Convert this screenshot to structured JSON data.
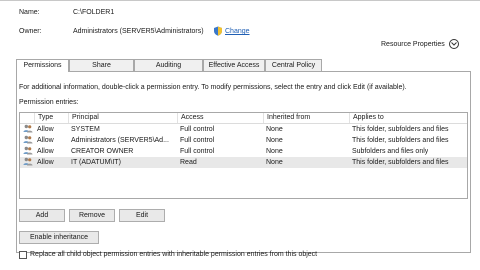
{
  "header": {
    "name_label": "Name:",
    "name_value": "C:\\FOLDER1",
    "owner_label": "Owner:",
    "owner_value": "Administrators (SERVER5\\Administrators)",
    "change_link": "Change",
    "resource_properties": "Resource Properties"
  },
  "tabs": [
    "Permissions",
    "Share",
    "Auditing",
    "Effective Access",
    "Central Policy"
  ],
  "active_tab": "Permissions",
  "info_text": "For additional information, double-click a permission entry. To modify permissions, select the entry and click Edit (if available).",
  "entries_label": "Permission entries:",
  "table": {
    "columns": [
      "Type",
      "Principal",
      "Access",
      "Inherited from",
      "Applies to"
    ],
    "rows": [
      [
        "Allow",
        "SYSTEM",
        "Full control",
        "None",
        "This folder, subfolders and files"
      ],
      [
        "Allow",
        "Administrators (SERVER5\\Ad...",
        "Full control",
        "None",
        "This folder, subfolders and files"
      ],
      [
        "Allow",
        "CREATOR OWNER",
        "Full control",
        "None",
        "Subfolders and files only"
      ],
      [
        "Allow",
        "IT (ADATUM\\IT)",
        "Read",
        "None",
        "This folder, subfolders and files"
      ]
    ],
    "selected_row": 3
  },
  "buttons": {
    "add": "Add",
    "remove": "Remove",
    "edit": "Edit",
    "enable_inheritance": "Enable inheritance"
  },
  "replace_checkbox_label": "Replace all child object permission entries with inheritable permission entries from this object",
  "icons": {
    "change": "shield-icon",
    "resource_properties": "chevron-down-icon",
    "principal": "users-icon"
  }
}
